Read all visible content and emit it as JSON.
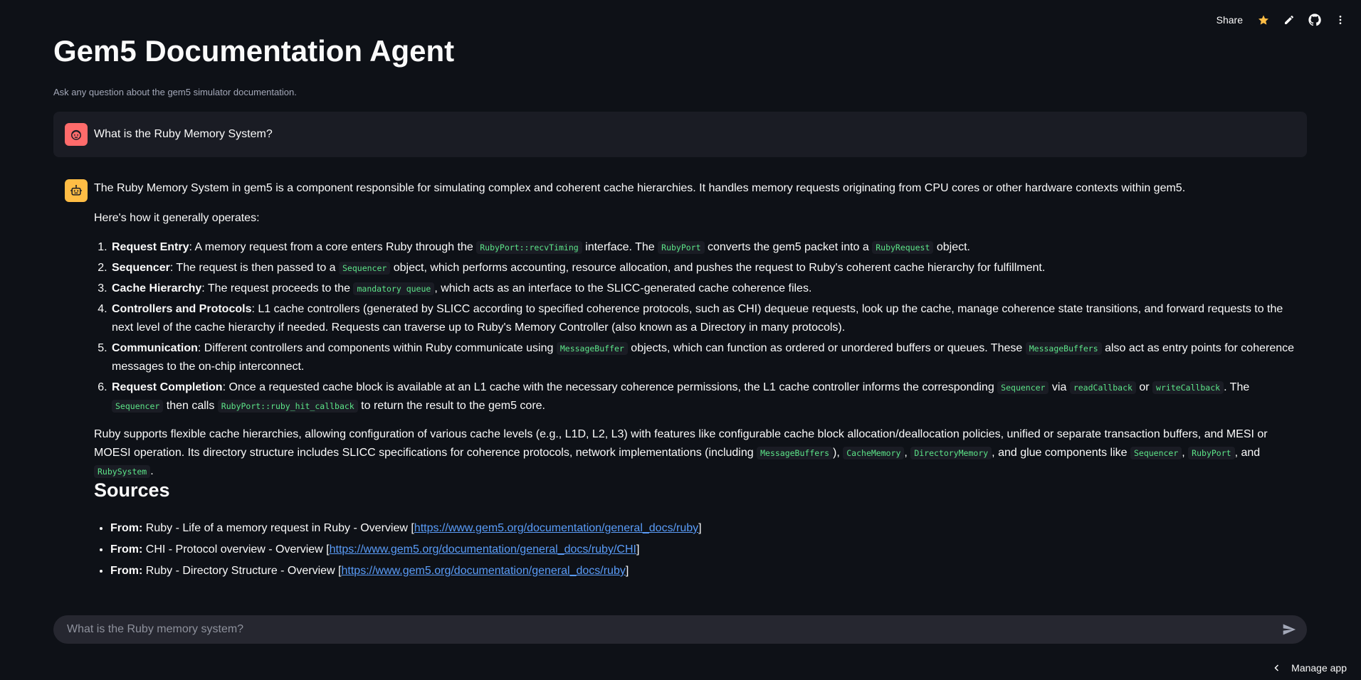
{
  "header": {
    "share_label": "Share",
    "icons": [
      "star-icon",
      "edit-icon",
      "github-icon",
      "more-vertical-icon"
    ]
  },
  "page": {
    "title": "Gem5 Documentation Agent",
    "subtitle": "Ask any question about the gem5 simulator documentation."
  },
  "user_message": {
    "text": "What is the Ruby Memory System?"
  },
  "assistant_message": {
    "intro": "The Ruby Memory System in gem5 is a component responsible for simulating complex and coherent cache hierarchies. It handles memory requests originating from CPU cores or other hardware contexts within gem5.",
    "lead": "Here's how it generally operates:",
    "steps": [
      {
        "title": "Request Entry",
        "parts": [
          ": A memory request from a core enters Ruby through the ",
          "RubyPort::recvTiming",
          " interface. The ",
          "RubyPort",
          " converts the gem5 packet into a ",
          "RubyRequest",
          " object."
        ]
      },
      {
        "title": "Sequencer",
        "parts": [
          ": The request is then passed to a ",
          "Sequencer",
          " object, which performs accounting, resource allocation, and pushes the request to Ruby's coherent cache hierarchy for fulfillment."
        ]
      },
      {
        "title": "Cache Hierarchy",
        "parts": [
          ": The request proceeds to the ",
          "mandatory queue",
          ", which acts as an interface to the SLICC-generated cache coherence files."
        ]
      },
      {
        "title": "Controllers and Protocols",
        "parts": [
          ": L1 cache controllers (generated by SLICC according to specified coherence protocols, such as CHI) dequeue requests, look up the cache, manage coherence state transitions, and forward requests to the next level of the cache hierarchy if needed. Requests can traverse up to Ruby's Memory Controller (also known as a Directory in many protocols)."
        ]
      },
      {
        "title": "Communication",
        "parts": [
          ": Different controllers and components within Ruby communicate using ",
          "MessageBuffer",
          " objects, which can function as ordered or unordered buffers or queues. These ",
          "MessageBuffers",
          " also act as entry points for coherence messages to the on-chip interconnect."
        ]
      },
      {
        "title": "Request Completion",
        "parts": [
          ": Once a requested cache block is available at an L1 cache with the necessary coherence permissions, the L1 cache controller informs the corresponding ",
          "Sequencer",
          " via ",
          "readCallback",
          " or ",
          "writeCallback",
          ". The ",
          "Sequencer",
          " then calls ",
          "RubyPort::ruby_hit_callback",
          " to return the result to the gem5 core."
        ]
      }
    ],
    "closing_parts": [
      "Ruby supports flexible cache hierarchies, allowing configuration of various cache levels (e.g., L1D, L2, L3) with features like configurable cache block allocation/deallocation policies, unified or separate transaction buffers, and MESI or MOESI operation. Its directory structure includes SLICC specifications for coherence protocols, network implementations (including ",
      "MessageBuffers",
      "), ",
      "CacheMemory",
      ", ",
      "DirectoryMemory",
      ", and glue components like ",
      "Sequencer",
      ", ",
      "RubyPort",
      ", and ",
      "RubySystem",
      "."
    ],
    "sources_heading": "Sources",
    "sources": [
      {
        "prefix": "From:",
        "text": " Ruby - Life of a memory request in Ruby - Overview [",
        "link": "https://www.gem5.org/documentation/general_docs/ruby",
        "suffix": "]"
      },
      {
        "prefix": "From:",
        "text": " CHI - Protocol overview - Overview [",
        "link": "https://www.gem5.org/documentation/general_docs/ruby/CHI",
        "suffix": "]"
      },
      {
        "prefix": "From:",
        "text": " Ruby - Directory Structure - Overview [",
        "link": "https://www.gem5.org/documentation/general_docs/ruby",
        "suffix": "]"
      }
    ]
  },
  "chat_input": {
    "placeholder": "What is the Ruby memory system?"
  },
  "footer": {
    "manage_label": "Manage app"
  }
}
